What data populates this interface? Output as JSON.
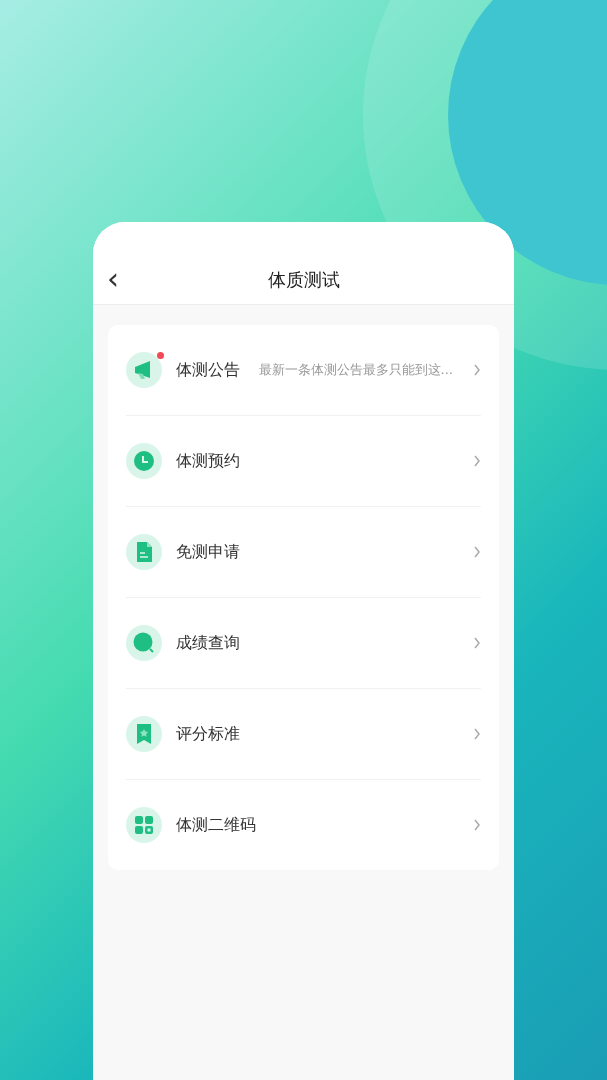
{
  "header": {
    "back": "‹",
    "title": "体质测试"
  },
  "menu": [
    {
      "kind": "megaphone",
      "label": "体测公告",
      "badge": true,
      "subtitle": "最新一条体测公告最多只能到这..."
    },
    {
      "kind": "clock",
      "label": "体测预约",
      "badge": false
    },
    {
      "kind": "document",
      "label": "免测申请",
      "badge": false
    },
    {
      "kind": "search",
      "label": "成绩查询",
      "badge": false
    },
    {
      "kind": "bookmark",
      "label": "评分标准",
      "badge": false
    },
    {
      "kind": "grid",
      "label": "体测二维码",
      "badge": false
    }
  ]
}
